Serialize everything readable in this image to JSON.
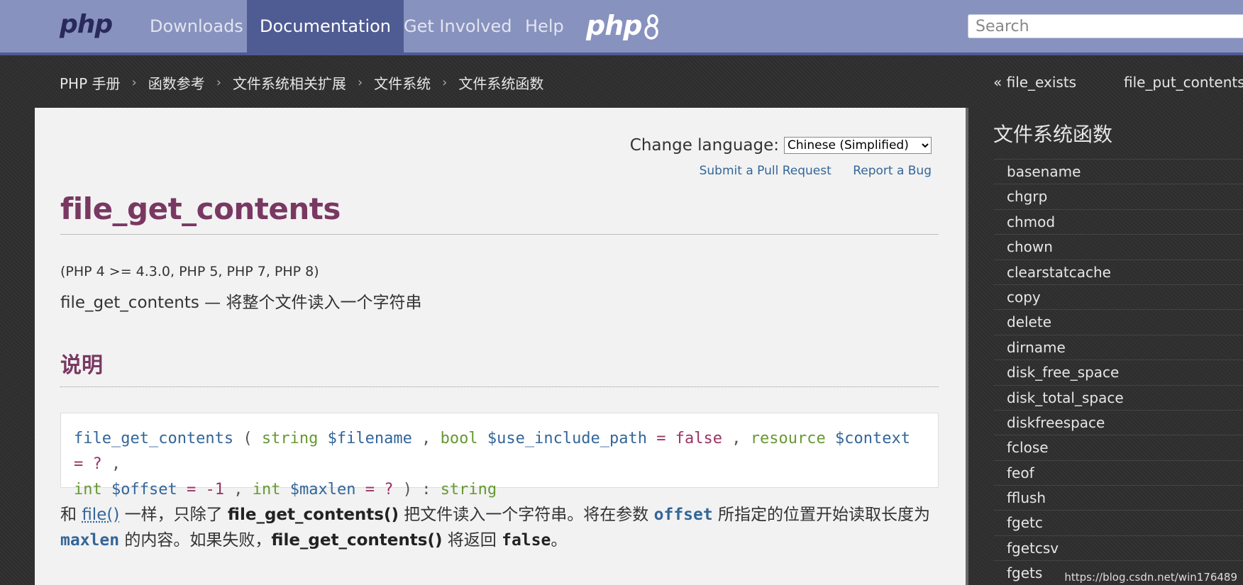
{
  "navbar": {
    "logo": "php",
    "items": [
      "Downloads",
      "Documentation",
      "Get Involved",
      "Help"
    ],
    "active": "Documentation",
    "logo8": "php",
    "search_placeholder": "Search"
  },
  "breadcrumb": {
    "items": [
      "PHP 手册",
      "函数参考",
      "文件系统相关扩展",
      "文件系统",
      "文件系统函数"
    ],
    "separator": "›"
  },
  "prevnext": {
    "prev": "« file_exists",
    "next": "file_put_contents"
  },
  "content": {
    "change_language_label": "Change language:",
    "language_selected": "Chinese (Simplified)",
    "submit_pr": "Submit a Pull Request",
    "report_bug": "Report a Bug",
    "title": "file_get_contents",
    "versions": "(PHP 4 >= 4.3.0, PHP 5, PHP 7, PHP 8)",
    "refpurpose": "file_get_contents — 将整个文件读入一个字符串",
    "description_heading": "说明",
    "synopsis": {
      "function": "file_get_contents",
      "params": [
        {
          "type": "string",
          "name": "$filename"
        },
        {
          "type": "bool",
          "name": "$use_include_path",
          "default": "false"
        },
        {
          "type": "resource",
          "name": "$context",
          "default": "?"
        },
        {
          "type": "int",
          "name": "$offset",
          "default": "-1"
        },
        {
          "type": "int",
          "name": "$maxlen",
          "default": "?"
        }
      ],
      "return_type": "string"
    },
    "paragraph": {
      "p1": "和 ",
      "link_file": "file()",
      "p2": " 一样，只除了 ",
      "fn1": "file_get_contents()",
      "p3": " 把文件读入一个字符串。将在参数 ",
      "param_offset": "offset",
      "p4": " 所指定的位置开始读取长度为",
      "param_maxlen": "maxlen",
      "p5": " 的内容。如果失败，",
      "fn2": "file_get_contents()",
      "p6": " 将返回 ",
      "false_lit": "false",
      "p7": "。"
    }
  },
  "sidebar": {
    "title": "文件系统函数",
    "items": [
      "basename",
      "chgrp",
      "chmod",
      "chown",
      "clearstatcache",
      "copy",
      "delete",
      "dirname",
      "disk_free_space",
      "disk_total_space",
      "diskfreespace",
      "fclose",
      "feof",
      "fflush",
      "fgetc",
      "fgetcsv",
      "fgets"
    ]
  },
  "watermark": "https://blog.csdn.net/win176489"
}
